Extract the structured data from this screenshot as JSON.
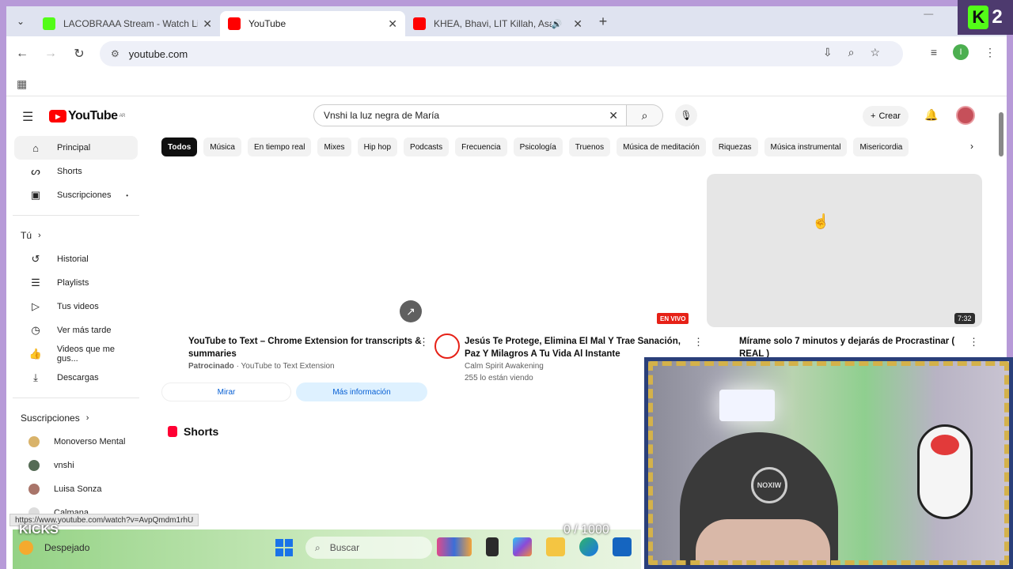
{
  "browser": {
    "tabs": [
      {
        "title": "LACOBRAAA Stream - Watch Li",
        "favicon_color": "#53fc18",
        "active": false,
        "audio": false
      },
      {
        "title": "YouTube",
        "favicon_color": "#ff0000",
        "active": true,
        "audio": false
      },
      {
        "title": "KHEA, Bhavi, LIT Killah, Asar",
        "favicon_color": "#ff0000",
        "active": false,
        "audio": true
      }
    ],
    "address": "youtube.com",
    "profile_initial": "I"
  },
  "overlay": {
    "kick_badge_letter": "K",
    "kick_badge_number": "2",
    "kicks_label": "KICKS",
    "goal_text": "0 / 1000",
    "status_url": "https://www.youtube.com/watch?v=AvpQmdm1rhU"
  },
  "youtube": {
    "logo_text": "YouTube",
    "logo_region": "AR",
    "search_value": "Vnshi la luz negra de María",
    "create_label": "Crear",
    "sidebar": {
      "main": [
        {
          "label": "Principal",
          "icon": "home-icon",
          "active": true
        },
        {
          "label": "Shorts",
          "icon": "shorts-icon",
          "active": false
        },
        {
          "label": "Suscripciones",
          "icon": "subscriptions-icon",
          "active": false
        }
      ],
      "you_header": "Tú",
      "you": [
        {
          "label": "Historial",
          "icon": "history-icon"
        },
        {
          "label": "Playlists",
          "icon": "playlists-icon"
        },
        {
          "label": "Tus videos",
          "icon": "your-videos-icon"
        },
        {
          "label": "Ver más tarde",
          "icon": "watch-later-icon"
        },
        {
          "label": "Videos que me gus...",
          "icon": "liked-icon"
        },
        {
          "label": "Descargas",
          "icon": "downloads-icon"
        }
      ],
      "subs_header": "Suscripciones",
      "subs": [
        {
          "label": "Monoverso Mental",
          "color": "#d9b36a"
        },
        {
          "label": "vnshi",
          "color": "#556b55"
        },
        {
          "label": "Luisa Sonza",
          "color": "#a9756a"
        },
        {
          "label": "Calmana",
          "color": "#dddddd"
        }
      ]
    },
    "chips": [
      "Todos",
      "Música",
      "En tiempo real",
      "Mixes",
      "Hip hop",
      "Podcasts",
      "Frecuencia",
      "Psicología",
      "Truenos",
      "Música de meditación",
      "Riquezas",
      "Música instrumental",
      "Misericordia"
    ],
    "videos": [
      {
        "title": "YouTube to Text – Chrome Extension for transcripts & summaries",
        "sponsor": "Patrocinado",
        "channel": "YouTube to Text Extension",
        "btn_watch": "Mirar",
        "btn_more": "Más información"
      },
      {
        "title": "Jesús Te Protege, Elimina El Mal Y Trae Sanación, Paz Y Milagros A Tu Vida Al Instante",
        "channel": "Calm Spirit Awakening",
        "meta": "255 lo están viendo",
        "badge": "EN VIVO"
      },
      {
        "title": "Mírame solo 7 minutos y dejarás de Procrastinar ( REAL )",
        "duration": "7:32"
      }
    ],
    "shorts_label": "Shorts"
  },
  "taskbar": {
    "weather": "Despejado",
    "search_placeholder": "Buscar"
  }
}
